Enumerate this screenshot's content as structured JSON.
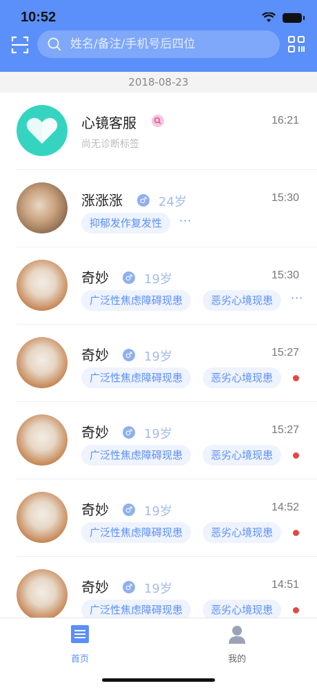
{
  "status_bar": {
    "time": "10:52"
  },
  "search": {
    "placeholder": "姓名/备注/手机号后四位"
  },
  "date_header": "2018-08-23",
  "items": [
    {
      "name": "心镜客服",
      "time": "16:21",
      "subtitle": "尚无诊断标签"
    },
    {
      "name": "涨涨涨",
      "age": "24岁",
      "time": "15:30",
      "tags": [
        "抑郁发作复发性"
      ],
      "more": "···"
    },
    {
      "name": "奇妙",
      "age": "19岁",
      "time": "15:30",
      "tags": [
        "广泛性焦虑障碍现患",
        "恶劣心境现患"
      ],
      "more": "···"
    },
    {
      "name": "奇妙",
      "age": "19岁",
      "time": "15:27",
      "tags": [
        "广泛性焦虑障碍现患",
        "恶劣心境现患"
      ],
      "unread": true
    },
    {
      "name": "奇妙",
      "age": "19岁",
      "time": "15:27",
      "tags": [
        "广泛性焦虑障碍现患",
        "恶劣心境现患"
      ],
      "unread": true
    },
    {
      "name": "奇妙",
      "age": "19岁",
      "time": "14:52",
      "tags": [
        "广泛性焦虑障碍现患",
        "恶劣心境现患"
      ],
      "unread": true
    },
    {
      "name": "奇妙",
      "age": "19岁",
      "time": "14:51",
      "tags": [
        "广泛性焦虑障碍现患",
        "恶劣心境现患"
      ],
      "unread": true
    }
  ],
  "tabs": [
    {
      "label": "首页",
      "icon": "home-list-icon",
      "active": true
    },
    {
      "label": "我的",
      "icon": "user-profile-icon",
      "active": false
    }
  ],
  "colors": {
    "brand": "#5b8ff9",
    "tag_bg": "#eef3fe",
    "unread": "#e84545",
    "inactive": "#777777"
  }
}
